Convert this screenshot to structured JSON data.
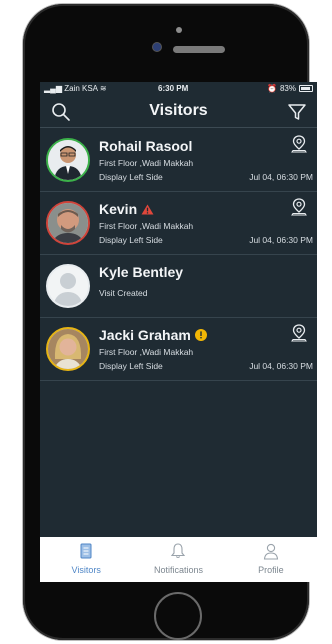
{
  "status": {
    "carrier": "Zain KSA",
    "time": "6:30 PM",
    "battery": "83%"
  },
  "header": {
    "title": "Visitors",
    "search_icon": "search-icon",
    "filter_icon": "filter-icon"
  },
  "visitors": [
    {
      "name": "Rohail Rasool",
      "location": "First Floor ,Wadi Makkah",
      "display": "Display Left Side",
      "date": "Jul 04, 06:30 PM",
      "ring": "#3cb24a",
      "badge": ""
    },
    {
      "name": "Kevin",
      "location": "First Floor ,Wadi Makkah",
      "display": "Display Left Side",
      "date": "Jul 04, 06:30 PM",
      "ring": "#d0443a",
      "badge": "warning"
    },
    {
      "name": "Kyle Bentley",
      "location": "Visit Created",
      "display": "",
      "date": "",
      "ring": "#cfd5da",
      "badge": ""
    },
    {
      "name": "Jacki Graham",
      "location": "First Floor ,Wadi Makkah",
      "display": "Display Left Side",
      "date": "Jul 04, 06:30 PM",
      "ring": "#e6b414",
      "badge": "info"
    }
  ],
  "tabs": [
    {
      "label": "Visitors",
      "icon": "clipboard-icon",
      "active": true
    },
    {
      "label": "Notifications",
      "icon": "bell-icon",
      "active": false
    },
    {
      "label": "Profile",
      "icon": "user-icon",
      "active": false
    }
  ],
  "colors": {
    "background": "#1f2b33",
    "active": "#4f86c6",
    "warning": "#e0473b",
    "info": "#f2b705"
  }
}
